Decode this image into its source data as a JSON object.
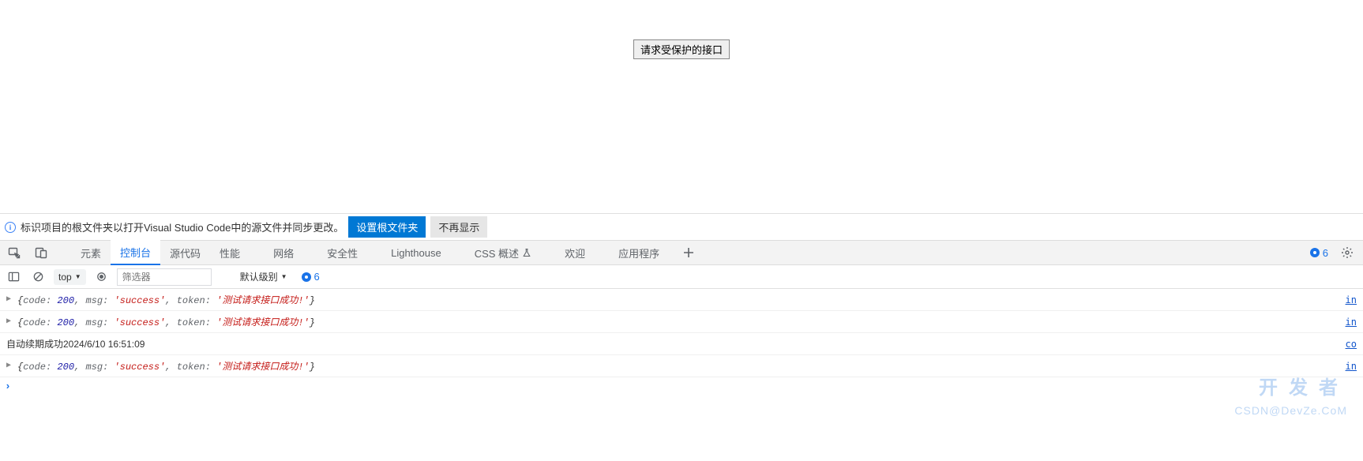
{
  "page": {
    "request_button_label": "请求受保护的接口"
  },
  "infoBar": {
    "message": "标识项目的根文件夹以打开Visual Studio Code中的源文件并同步更改。",
    "primary_btn": "设置根文件夹",
    "secondary_btn": "不再显示"
  },
  "tabs": {
    "items": [
      "元素",
      "控制台",
      "源代码",
      "性能",
      "网络",
      "安全性",
      "Lighthouse",
      "CSS 概述",
      "欢迎",
      "应用程序"
    ],
    "active_index": 1,
    "issues_count": "6"
  },
  "toolbar": {
    "context": "top",
    "filter_placeholder": "筛选器",
    "levels_label": "默认级别",
    "issues_count": "6"
  },
  "console": {
    "lines": [
      {
        "type": "object",
        "code": "200",
        "msg": "success",
        "tokenLabel": "token",
        "tokenValue": "测试请求接口成功!",
        "src": "in"
      },
      {
        "type": "object",
        "code": "200",
        "msg": "success",
        "tokenLabel": "token",
        "tokenValue": "测试请求接口成功!",
        "src": "in"
      },
      {
        "type": "plain",
        "text": "自动续期成功2024/6/10 16:51:09",
        "src": "co"
      },
      {
        "type": "object",
        "code": "200",
        "msg": "success",
        "tokenLabel": "token",
        "tokenValue": "测试请求接口成功!",
        "src": "in"
      }
    ]
  },
  "watermark": {
    "big": "开发者",
    "small": "CSDN@DevZe.CoM"
  }
}
